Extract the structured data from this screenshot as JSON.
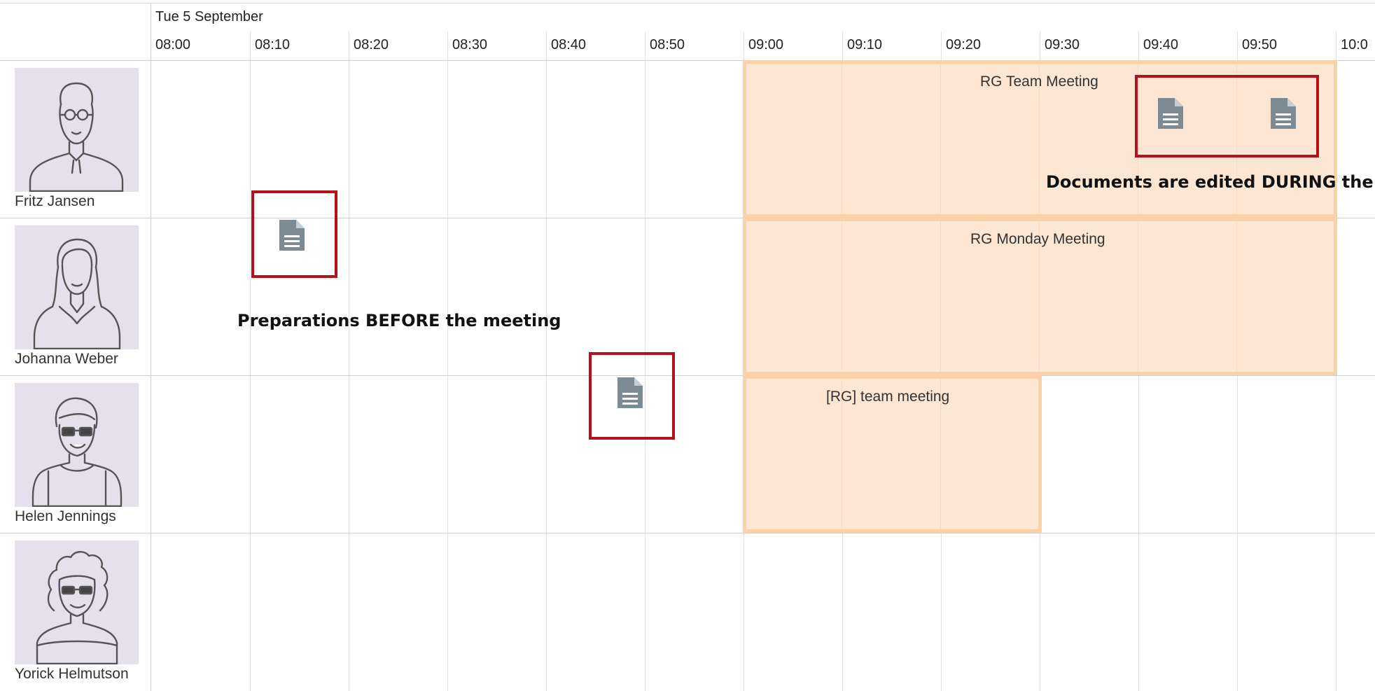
{
  "calendar": {
    "date": "Tue 5 September",
    "times": [
      "08:00",
      "08:10",
      "08:20",
      "08:30",
      "08:40",
      "08:50",
      "09:00",
      "09:10",
      "09:20",
      "09:30",
      "09:40",
      "09:50",
      "10:0"
    ]
  },
  "people": [
    {
      "name": "Fritz Jansen",
      "avatar": "man-glasses-avatar-icon"
    },
    {
      "name": "Johanna Weber",
      "avatar": "woman-long-hair-avatar-icon"
    },
    {
      "name": "Helen Jennings",
      "avatar": "woman-glasses-avatar-icon"
    },
    {
      "name": "Yorick Helmutson",
      "avatar": "curly-hair-glasses-avatar-icon"
    }
  ],
  "events": [
    {
      "title": "RG Team Meeting",
      "color": "#fde6d3"
    },
    {
      "title": "RG Monday Meeting",
      "color": "#fde6d3"
    },
    {
      "title": "[RG] team meeting",
      "color": "#fde6d3"
    }
  ],
  "annotations": {
    "during": "Documents are edited DURING the",
    "before": "Preparations BEFORE the meeting"
  },
  "colors": {
    "event_fill": "#fde6d3",
    "event_border": "#fbd2a7",
    "highlight_box": "#b4121b",
    "doc_icon": "#7b8a93",
    "avatar_bg": "#e6e0ec"
  },
  "icons": {
    "document": "document-icon"
  }
}
